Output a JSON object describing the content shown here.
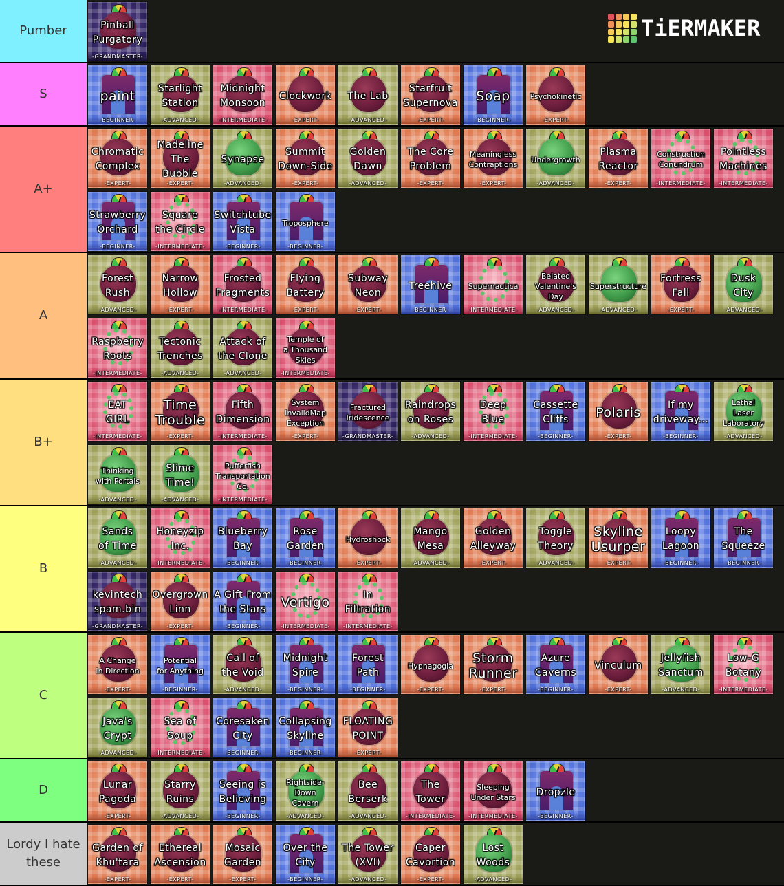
{
  "logo": {
    "text": "TiERMAKER",
    "grid_colors": [
      "#e2525f",
      "#f0915a",
      "#f6c85a",
      "#f8e35c",
      "#f0915a",
      "#f6c85a",
      "#f8e35c",
      "#d3e36a",
      "#f6c85a",
      "#f8e35c",
      "#d3e36a",
      "#8fd36c",
      "#f8e35c",
      "#d3e36a",
      "#8fd36c",
      "#5fc46c"
    ]
  },
  "difficulty_styles": {
    "BEGINNER": {
      "bg1": "#4f6fd8",
      "bg2": "#8ea6ff",
      "accent": "#2a3fa0"
    },
    "INTERMEDIATE": {
      "bg1": "#d94f6d",
      "bg2": "#f7b6c2",
      "accent": "#a02040"
    },
    "ADVANCED": {
      "bg1": "#9ea05a",
      "bg2": "#d4d6a0",
      "accent": "#6a6d2a"
    },
    "EXPERT": {
      "bg1": "#e07a52",
      "bg2": "#f4c2a2",
      "accent": "#a8482a"
    },
    "GRANDMASTER": {
      "bg1": "#2a1f5a",
      "bg2": "#6a4fa0",
      "accent": "#140c30"
    }
  },
  "tiers": [
    {
      "label": "Pumber",
      "color": "#7ff0ff",
      "items": [
        {
          "name": "Pinball\nPurgatory",
          "difficulty": "GRANDMASTER",
          "diff_label": "-GRANDMASTER-",
          "icon": "blob-icon"
        }
      ]
    },
    {
      "label": "S",
      "color": "#ff7fff",
      "items": [
        {
          "name": "paint",
          "difficulty": "BEGINNER",
          "diff_label": "-BEGINNER-",
          "icon": "gate-icon",
          "size": "big"
        },
        {
          "name": "Starlight\nStation",
          "difficulty": "ADVANCED",
          "diff_label": "-ADVANCED-",
          "icon": "blob-icon"
        },
        {
          "name": "Midnight\nMonsoon",
          "difficulty": "INTERMEDIATE",
          "diff_label": "-INTERMEDIATE-",
          "icon": "blob-icon"
        },
        {
          "name": "Clockwork",
          "difficulty": "EXPERT",
          "diff_label": "-EXPERT-",
          "icon": "blob-icon"
        },
        {
          "name": "The Lab",
          "difficulty": "ADVANCED",
          "diff_label": "-ADVANCED-",
          "icon": "blob-icon"
        },
        {
          "name": "Starfruit\nSupernova",
          "difficulty": "EXPERT",
          "diff_label": "-EXPERT-",
          "icon": "blob-icon"
        },
        {
          "name": "Soap",
          "difficulty": "BEGINNER",
          "diff_label": "-BEGINNER-",
          "icon": "gate-icon",
          "size": "big"
        },
        {
          "name": "Psychokinetic",
          "difficulty": "EXPERT",
          "diff_label": "-EXPERT-",
          "icon": "blob-icon",
          "size": "small"
        }
      ]
    },
    {
      "label": "A+",
      "color": "#ff7f7f",
      "items": [
        {
          "name": "Chromatic\nComplex",
          "difficulty": "EXPERT",
          "diff_label": "-EXPERT-",
          "icon": "blob-icon"
        },
        {
          "name": "Madeline\nThe Bubble",
          "difficulty": "EXPERT",
          "diff_label": "-EXPERT-",
          "icon": "blob-icon"
        },
        {
          "name": "Synapse",
          "difficulty": "ADVANCED",
          "diff_label": "-ADVANCED-",
          "icon": "green-blob-icon"
        },
        {
          "name": "Summit\nDown-Side",
          "difficulty": "EXPERT",
          "diff_label": "-EXPERT-",
          "icon": "blob-icon"
        },
        {
          "name": "Golden\nDawn",
          "difficulty": "ADVANCED",
          "diff_label": "-ADVANCED-",
          "icon": "blob-icon"
        },
        {
          "name": "The Core\nProblem",
          "difficulty": "EXPERT",
          "diff_label": "-EXPERT-",
          "icon": "blob-icon"
        },
        {
          "name": "Meaningless\nContraptions",
          "difficulty": "EXPERT",
          "diff_label": "-EXPERT-",
          "icon": "blob-icon",
          "size": "small"
        },
        {
          "name": "Undergrowth",
          "difficulty": "ADVANCED",
          "diff_label": "-ADVANCED-",
          "icon": "green-blob-icon",
          "size": "small"
        },
        {
          "name": "Plasma\nReactor",
          "difficulty": "EXPERT",
          "diff_label": "-EXPERT-",
          "icon": "blob-icon"
        },
        {
          "name": "Construction\nConundrum",
          "difficulty": "INTERMEDIATE",
          "diff_label": "-INTERMEDIATE-",
          "icon": "ring-icon",
          "size": "small"
        },
        {
          "name": "Pointless\nMachines",
          "difficulty": "INTERMEDIATE",
          "diff_label": "-INTERMEDIATE-",
          "icon": "ring-icon"
        },
        {
          "name": "Strawberry\nOrchard",
          "difficulty": "BEGINNER",
          "diff_label": "-BEGINNER-",
          "icon": "gate-icon"
        },
        {
          "name": "Square\nthe Circle",
          "difficulty": "INTERMEDIATE",
          "diff_label": "-INTERMEDIATE-",
          "icon": "ring-icon"
        },
        {
          "name": "Switchtube\nVista",
          "difficulty": "BEGINNER",
          "diff_label": "-BEGINNER-",
          "icon": "gate-icon"
        },
        {
          "name": "Troposphere",
          "difficulty": "BEGINNER",
          "diff_label": "-BEGINNER-",
          "icon": "gate-icon",
          "size": "small"
        }
      ]
    },
    {
      "label": "A",
      "color": "#ffbf7f",
      "items": [
        {
          "name": "Forest\nRush",
          "difficulty": "ADVANCED",
          "diff_label": "-ADVANCED-",
          "icon": "blob-icon"
        },
        {
          "name": "Narrow\nHollow",
          "difficulty": "EXPERT",
          "diff_label": "-EXPERT-",
          "icon": "blob-icon"
        },
        {
          "name": "Frosted\nFragments",
          "difficulty": "INTERMEDIATE",
          "diff_label": "-INTERMEDIATE-",
          "icon": "blob-icon"
        },
        {
          "name": "Flying\nBattery",
          "difficulty": "EXPERT",
          "diff_label": "-EXPERT-",
          "icon": "blob-icon"
        },
        {
          "name": "Subway\nNeon",
          "difficulty": "EXPERT",
          "diff_label": "-EXPERT-",
          "icon": "blob-icon"
        },
        {
          "name": "Treehive",
          "difficulty": "BEGINNER",
          "diff_label": "-BEGINNER-",
          "icon": "gate-icon"
        },
        {
          "name": "Supernautica",
          "difficulty": "INTERMEDIATE",
          "diff_label": "-INTERMEDIATE-",
          "icon": "ring-icon",
          "size": "small"
        },
        {
          "name": "Belated\nValentine's\nDay",
          "difficulty": "ADVANCED",
          "diff_label": "-ADVANCED-",
          "icon": "blob-icon",
          "size": "small"
        },
        {
          "name": "Superstructure",
          "difficulty": "ADVANCED",
          "diff_label": "-ADVANCED-",
          "icon": "green-blob-icon",
          "size": "small"
        },
        {
          "name": "Fortress\nFall",
          "difficulty": "EXPERT",
          "diff_label": "-EXPERT-",
          "icon": "blob-icon"
        },
        {
          "name": "Dusk\nCity",
          "difficulty": "ADVANCED",
          "diff_label": "-ADVANCED-",
          "icon": "green-blob-icon"
        },
        {
          "name": "Raspberry\nRoots",
          "difficulty": "INTERMEDIATE",
          "diff_label": "-INTERMEDIATE-",
          "icon": "ring-icon"
        },
        {
          "name": "Tectonic\nTrenches",
          "difficulty": "ADVANCED",
          "diff_label": "-ADVANCED-",
          "icon": "blob-icon"
        },
        {
          "name": "Attack of\nthe Clone",
          "difficulty": "ADVANCED",
          "diff_label": "-ADVANCED-",
          "icon": "blob-icon"
        },
        {
          "name": "Temple of\na Thousand\nSkies",
          "difficulty": "INTERMEDIATE",
          "diff_label": "-INTERMEDIATE-",
          "icon": "blob-icon",
          "size": "small"
        }
      ]
    },
    {
      "label": "B+",
      "color": "#ffdf7f",
      "items": [
        {
          "name": "EAT\nGIRL",
          "difficulty": "INTERMEDIATE",
          "diff_label": "-INTERMEDIATE-",
          "icon": "ring-icon"
        },
        {
          "name": "Time\nTrouble",
          "difficulty": "EXPERT",
          "diff_label": "-EXPERT-",
          "icon": "blob-icon",
          "size": "big"
        },
        {
          "name": "Fifth\nDimension",
          "difficulty": "INTERMEDIATE",
          "diff_label": "-INTERMEDIATE-",
          "icon": "blob-icon"
        },
        {
          "name": "System\nInvalidMap\nException",
          "difficulty": "EXPERT",
          "diff_label": "-EXPERT-",
          "icon": "blob-icon",
          "size": "small"
        },
        {
          "name": "Fractured\nIridescence",
          "difficulty": "GRANDMASTER",
          "diff_label": "-GRANDMASTER-",
          "icon": "blob-icon",
          "size": "small"
        },
        {
          "name": "Raindrops\non Roses",
          "difficulty": "ADVANCED",
          "diff_label": "-ADVANCED-",
          "icon": "blob-icon"
        },
        {
          "name": "Deep\nBlue",
          "difficulty": "INTERMEDIATE",
          "diff_label": "-INTERMEDIATE-",
          "icon": "ring-icon"
        },
        {
          "name": "Cassette\nCliffs",
          "difficulty": "BEGINNER",
          "diff_label": "-BEGINNER-",
          "icon": "gate-icon"
        },
        {
          "name": "Polaris",
          "difficulty": "EXPERT",
          "diff_label": "-EXPERT-",
          "icon": "blob-icon",
          "size": "big"
        },
        {
          "name": "If my\ndriveway...",
          "difficulty": "BEGINNER",
          "diff_label": "-BEGINNER-",
          "icon": "gate-icon"
        },
        {
          "name": "Lethal\nLaser\nLaboratory",
          "difficulty": "ADVANCED",
          "diff_label": "-ADVANCED-",
          "icon": "green-blob-icon",
          "size": "small"
        },
        {
          "name": "Thinking\nwith Portals",
          "difficulty": "ADVANCED",
          "diff_label": "-ADVANCED-",
          "icon": "green-blob-icon",
          "size": "small"
        },
        {
          "name": "Slime\nTime!",
          "difficulty": "ADVANCED",
          "diff_label": "-ADVANCED-",
          "icon": "green-blob-icon"
        },
        {
          "name": "Pufferfish\nTransportation\nCo.",
          "difficulty": "INTERMEDIATE",
          "diff_label": "-INTERMEDIATE-",
          "icon": "ring-icon",
          "size": "small"
        }
      ]
    },
    {
      "label": "B",
      "color": "#ffff7f",
      "items": [
        {
          "name": "Sands\nof Time",
          "difficulty": "ADVANCED",
          "diff_label": "-ADVANCED-",
          "icon": "green-blob-icon"
        },
        {
          "name": "Honeyzip\nInc.",
          "difficulty": "INTERMEDIATE",
          "diff_label": "-INTERMEDIATE-",
          "icon": "ring-icon"
        },
        {
          "name": "Blueberry\nBay",
          "difficulty": "BEGINNER",
          "diff_label": "-BEGINNER-",
          "icon": "gate-icon"
        },
        {
          "name": "Rose\nGarden",
          "difficulty": "BEGINNER",
          "diff_label": "-BEGINNER-",
          "icon": "gate-icon"
        },
        {
          "name": "Hydroshock",
          "difficulty": "EXPERT",
          "diff_label": "-EXPERT-",
          "icon": "blob-icon",
          "size": "small"
        },
        {
          "name": "Mango\nMesa",
          "difficulty": "ADVANCED",
          "diff_label": "-ADVANCED-",
          "icon": "blob-icon"
        },
        {
          "name": "Golden\nAlleyway",
          "difficulty": "EXPERT",
          "diff_label": "-EXPERT-",
          "icon": "blob-icon"
        },
        {
          "name": "Toggle\nTheory",
          "difficulty": "ADVANCED",
          "diff_label": "-ADVANCED-",
          "icon": "blob-icon"
        },
        {
          "name": "Skyline\nUsurper",
          "difficulty": "EXPERT",
          "diff_label": "-EXPERT-",
          "icon": "blob-icon",
          "size": "big"
        },
        {
          "name": "Loopy\nLagoon",
          "difficulty": "BEGINNER",
          "diff_label": "-BEGINNER-",
          "icon": "gate-icon"
        },
        {
          "name": "The\nSqueeze",
          "difficulty": "BEGINNER",
          "diff_label": "-BEGINNER-",
          "icon": "gate-icon"
        },
        {
          "name": "kevintech\nspam.bin",
          "difficulty": "GRANDMASTER",
          "diff_label": "-GRANDMASTER-",
          "icon": "blob-icon"
        },
        {
          "name": "Overgrown\nLinn",
          "difficulty": "EXPERT",
          "diff_label": "-EXPERT-",
          "icon": "blob-icon"
        },
        {
          "name": "A Gift From\nthe Stars",
          "difficulty": "BEGINNER",
          "diff_label": "-BEGINNER-",
          "icon": "gate-icon"
        },
        {
          "name": "Vertigo",
          "difficulty": "INTERMEDIATE",
          "diff_label": "-INTERMEDIATE-",
          "icon": "ring-icon",
          "size": "big"
        },
        {
          "name": "In\nFiltration",
          "difficulty": "INTERMEDIATE",
          "diff_label": "-INTERMEDIATE-",
          "icon": "ring-icon"
        }
      ]
    },
    {
      "label": "C",
      "color": "#bfff7f",
      "items": [
        {
          "name": "A Change\nin Direction",
          "difficulty": "EXPERT",
          "diff_label": "-EXPERT-",
          "icon": "blob-icon",
          "size": "small"
        },
        {
          "name": "Potential\nfor Anything",
          "difficulty": "BEGINNER",
          "diff_label": "-BEGINNER-",
          "icon": "gate-icon",
          "size": "small"
        },
        {
          "name": "Call of\nthe Void",
          "difficulty": "ADVANCED",
          "diff_label": "-ADVANCED-",
          "icon": "blob-icon"
        },
        {
          "name": "Midnight\nSpire",
          "difficulty": "BEGINNER",
          "diff_label": "-BEGINNER-",
          "icon": "gate-icon"
        },
        {
          "name": "Forest\nPath",
          "difficulty": "BEGINNER",
          "diff_label": "-BEGINNER-",
          "icon": "gate-icon"
        },
        {
          "name": "Hypnagogia",
          "difficulty": "EXPERT",
          "diff_label": "-EXPERT-",
          "icon": "blob-icon",
          "size": "small"
        },
        {
          "name": "Storm\nRunner",
          "difficulty": "EXPERT",
          "diff_label": "-EXPERT-",
          "icon": "blob-icon",
          "size": "big"
        },
        {
          "name": "Azure\nCaverns",
          "difficulty": "BEGINNER",
          "diff_label": "-BEGINNER-",
          "icon": "gate-icon"
        },
        {
          "name": "Vinculum",
          "difficulty": "EXPERT",
          "diff_label": "-EXPERT-",
          "icon": "blob-icon"
        },
        {
          "name": "Jellyfish\nSanctum",
          "difficulty": "ADVANCED",
          "diff_label": "-ADVANCED-",
          "icon": "green-blob-icon"
        },
        {
          "name": "Low-G\nBotany",
          "difficulty": "INTERMEDIATE",
          "diff_label": "-INTERMEDIATE-",
          "icon": "ring-icon"
        },
        {
          "name": "Java's\nCrypt",
          "difficulty": "ADVANCED",
          "diff_label": "-ADVANCED-",
          "icon": "green-blob-icon"
        },
        {
          "name": "Sea of\nSoup",
          "difficulty": "INTERMEDIATE",
          "diff_label": "-INTERMEDIATE-",
          "icon": "ring-icon"
        },
        {
          "name": "Coresaken\nCity",
          "difficulty": "BEGINNER",
          "diff_label": "-BEGINNER-",
          "icon": "gate-icon"
        },
        {
          "name": "Collapsing\nSkyline",
          "difficulty": "BEGINNER",
          "diff_label": "-BEGINNER-",
          "icon": "gate-icon"
        },
        {
          "name": "FLOATING\nPOINT",
          "difficulty": "EXPERT",
          "diff_label": "-EXPERT-",
          "icon": "blob-icon"
        }
      ]
    },
    {
      "label": "D",
      "color": "#7fff7f",
      "items": [
        {
          "name": "Lunar\nPagoda",
          "difficulty": "EXPERT",
          "diff_label": "-EXPERT-",
          "icon": "blob-icon"
        },
        {
          "name": "Starry\nRuins",
          "difficulty": "ADVANCED",
          "diff_label": "-ADVANCED-",
          "icon": "blob-icon"
        },
        {
          "name": "Seeing is\nBelieving",
          "difficulty": "BEGINNER",
          "diff_label": "-BEGINNER-",
          "icon": "gate-icon"
        },
        {
          "name": "Rightside-Down\nCavern",
          "difficulty": "ADVANCED",
          "diff_label": "-ADVANCED-",
          "icon": "green-blob-icon",
          "size": "small"
        },
        {
          "name": "Bee\nBerserk",
          "difficulty": "ADVANCED",
          "diff_label": "-ADVANCED-",
          "icon": "blob-icon"
        },
        {
          "name": "The\nTower",
          "difficulty": "INTERMEDIATE",
          "diff_label": "-INTERMEDIATE-",
          "icon": "blob-icon"
        },
        {
          "name": "Sleeping\nUnder Stars",
          "difficulty": "INTERMEDIATE",
          "diff_label": "-INTERMEDIATE-",
          "icon": "blob-icon",
          "size": "small"
        },
        {
          "name": "Dropzle",
          "difficulty": "BEGINNER",
          "diff_label": "-BEGINNER-",
          "icon": "gate-icon"
        }
      ]
    },
    {
      "label": "Lordy I hate\nthese",
      "color": "#cccccc",
      "items": [
        {
          "name": "Garden of\nKhu'tara",
          "difficulty": "EXPERT",
          "diff_label": "-EXPERT-",
          "icon": "blob-icon"
        },
        {
          "name": "Ethereal\nAscension",
          "difficulty": "EXPERT",
          "diff_label": "-EXPERT-",
          "icon": "blob-icon"
        },
        {
          "name": "Mosaic\nGarden",
          "difficulty": "EXPERT",
          "diff_label": "-EXPERT-",
          "icon": "blob-icon"
        },
        {
          "name": "Over the\nCity",
          "difficulty": "BEGINNER",
          "diff_label": "-BEGINNER-",
          "icon": "gate-icon"
        },
        {
          "name": "The Tower\n(XVI)",
          "difficulty": "ADVANCED",
          "diff_label": "-ADVANCED-",
          "icon": "blob-icon"
        },
        {
          "name": "Caper\nCavortion",
          "difficulty": "EXPERT",
          "diff_label": "-EXPERT-",
          "icon": "blob-icon"
        },
        {
          "name": "Lost\nWoods",
          "difficulty": "ADVANCED",
          "diff_label": "-ADVANCED-",
          "icon": "green-blob-icon"
        }
      ]
    }
  ]
}
